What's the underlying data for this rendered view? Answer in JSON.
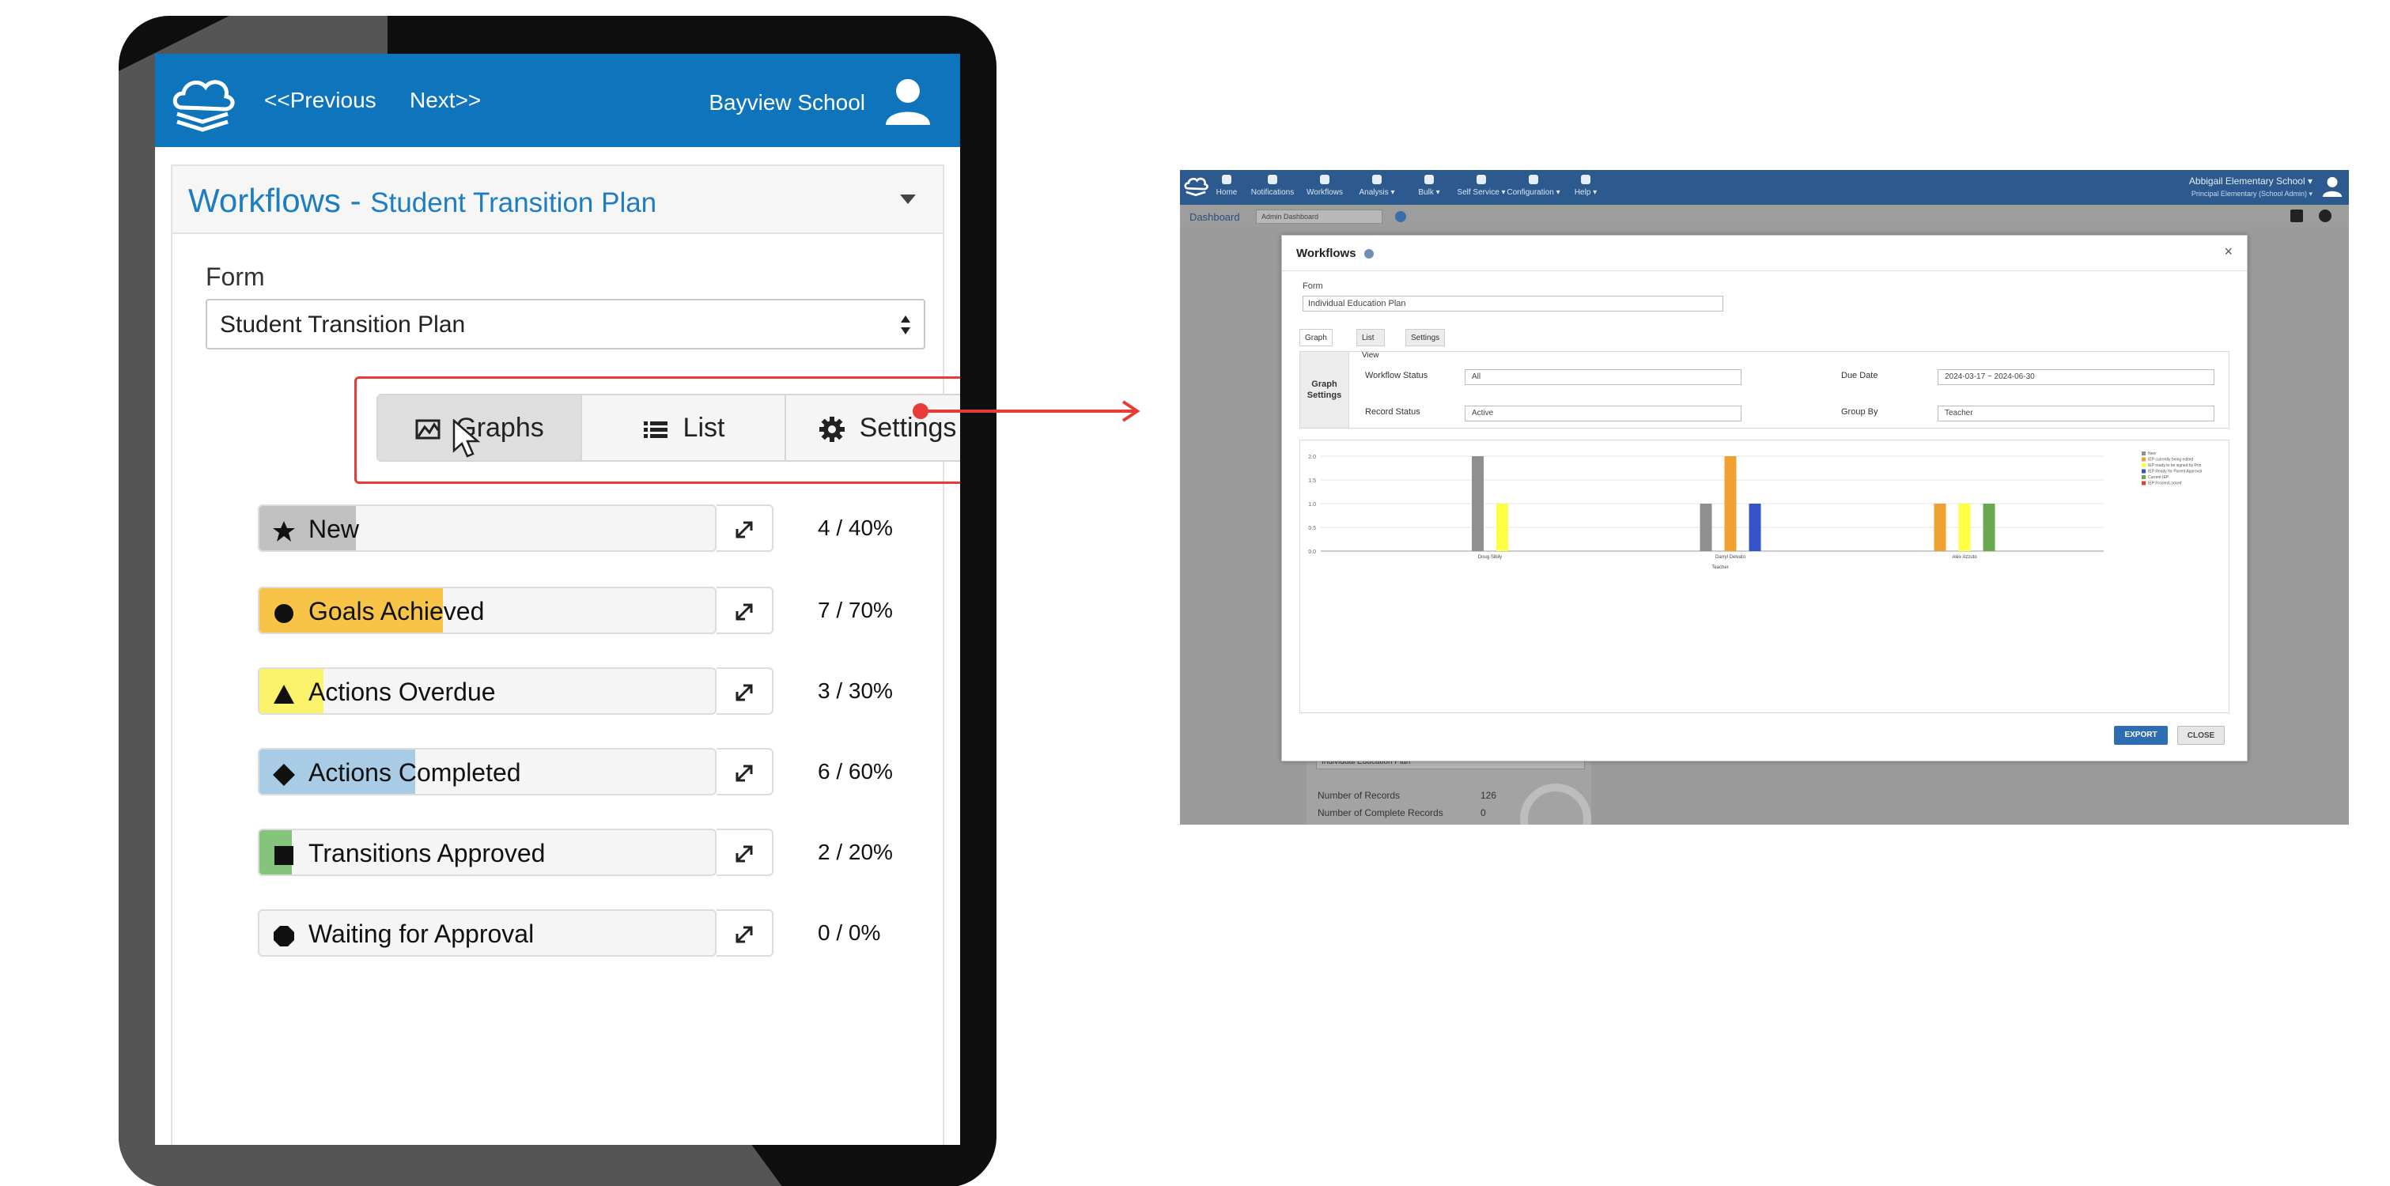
{
  "tablet": {
    "nav": {
      "previous": "<<Previous",
      "next": "Next>>",
      "school": "Bayview School"
    },
    "header": {
      "title": "Workflows",
      "separator": " - ",
      "subtitle": "Student Transition Plan"
    },
    "form": {
      "label": "Form",
      "value": "Student Transition Plan"
    },
    "tabs": [
      {
        "label": "Graphs",
        "icon": "chart-icon",
        "active": true
      },
      {
        "label": "List",
        "icon": "list-icon",
        "active": false
      },
      {
        "label": "Settings",
        "icon": "gear-icon",
        "active": false
      }
    ],
    "statuses": [
      {
        "label": "New",
        "shape": "star",
        "color": "#c0c0c0",
        "count": "4 / 40%",
        "fill_fraction": 0.21
      },
      {
        "label": "Goals Achieved",
        "shape": "circle",
        "color": "#f7c448",
        "count": "7 / 70%",
        "fill_fraction": 0.4
      },
      {
        "label": "Actions Overdue",
        "shape": "triangle",
        "color": "#fcf36c",
        "count": "3 / 30%",
        "fill_fraction": 0.14
      },
      {
        "label": "Actions Completed",
        "shape": "diamond",
        "color": "#a8cbe6",
        "count": "6 / 60%",
        "fill_fraction": 0.34
      },
      {
        "label": "Transitions Approved",
        "shape": "square",
        "color": "#86c37d",
        "count": "2 / 20%",
        "fill_fraction": 0.07
      },
      {
        "label": "Waiting for Approval",
        "shape": "octagon",
        "color": "#ffffff",
        "count": "0 / 0%",
        "fill_fraction": 0
      }
    ]
  },
  "desktop": {
    "top_nav": [
      "Home",
      "Notifications",
      "Workflows",
      "Analysis ▾",
      "Bulk ▾",
      "Self Service ▾",
      "Configuration ▾",
      "Help ▾"
    ],
    "school": "Abbigail Elementary School ▾",
    "role": "Principal Elementary (School Admin) ▾",
    "subbar": {
      "dashboard": "Dashboard",
      "select": "Admin Dashboard"
    },
    "behind": {
      "select": "Individual Education Plan",
      "records_label": "Number of Records",
      "records_value": "126",
      "complete_label": "Number of Complete Records",
      "complete_value": "0"
    },
    "modal": {
      "title": "Workflows",
      "close": "×",
      "form_label": "Form",
      "form_value": "Individual Education Plan",
      "tabs": [
        "Graph View",
        "List View",
        "Settings"
      ],
      "settings_title": "Graph Settings",
      "workflow_status_label": "Workflow Status",
      "workflow_status_value": "All",
      "record_status_label": "Record Status",
      "record_status_value": "Active",
      "due_date_label": "Due Date",
      "due_date_value": "2024-03-17 ~ 2024-06-30",
      "group_by_label": "Group By",
      "group_by_value": "Teacher",
      "export": "EXPORT",
      "close_btn": "CLOSE"
    }
  },
  "chart_data": {
    "type": "bar",
    "xlabel": "Teacher",
    "ylabel": "",
    "ylim": [
      0,
      2.0
    ],
    "yticks": [
      "0.0",
      "0.5",
      "1.0",
      "1.5",
      "2.0"
    ],
    "categories": [
      "Doug Sibily",
      "Darryl Delvato",
      "Alex Azzuto"
    ],
    "legend_position": "right",
    "series": [
      {
        "name": "New",
        "color": "#8f8f8f",
        "values": [
          2,
          1,
          0
        ]
      },
      {
        "name": "IEP currently being edited",
        "color": "#f0a030",
        "values": [
          0,
          2,
          1
        ]
      },
      {
        "name": "IEP ready to be signed by Prin",
        "color": "#ffff44",
        "values": [
          1,
          0,
          1
        ]
      },
      {
        "name": "IEP Ready for Parent Approval",
        "color": "#3553c9",
        "values": [
          0,
          1,
          0
        ]
      },
      {
        "name": "Current IEP",
        "color": "#6aa84f",
        "values": [
          0,
          0,
          1
        ]
      },
      {
        "name": "IEP Frozen/Locked",
        "color": "#d9432f",
        "values": [
          0,
          0,
          0
        ]
      }
    ]
  }
}
